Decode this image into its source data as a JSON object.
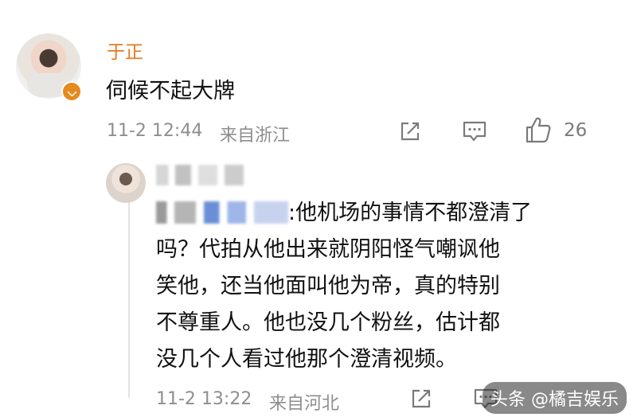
{
  "comment": {
    "username": "于正",
    "text": "伺候不起大牌",
    "date": "11-2 12:44",
    "location": "来自浙江",
    "like_count": "26"
  },
  "reply": {
    "mention_suffix": ":",
    "lines": [
      "他机场的事情不都澄清了",
      "吗？代拍从他出来就阴阳怪气嘲讽他",
      "笑他，还当他面叫他为帝，真的特别",
      "不尊重人。他也没几个粉丝，估计都",
      "没几个人看过他那个澄清视频。"
    ],
    "date": "11-2 13:22",
    "location": "来自河北"
  },
  "watermark": "头条 @橘吉娱乐",
  "icons": {
    "share": "share-icon",
    "comment": "comment-icon",
    "like": "thumbs-up-icon",
    "verified": "verified-badge-icon"
  },
  "colors": {
    "username": "#e5791c",
    "meta": "#8e8e8e",
    "verified": "#e58a1e"
  }
}
